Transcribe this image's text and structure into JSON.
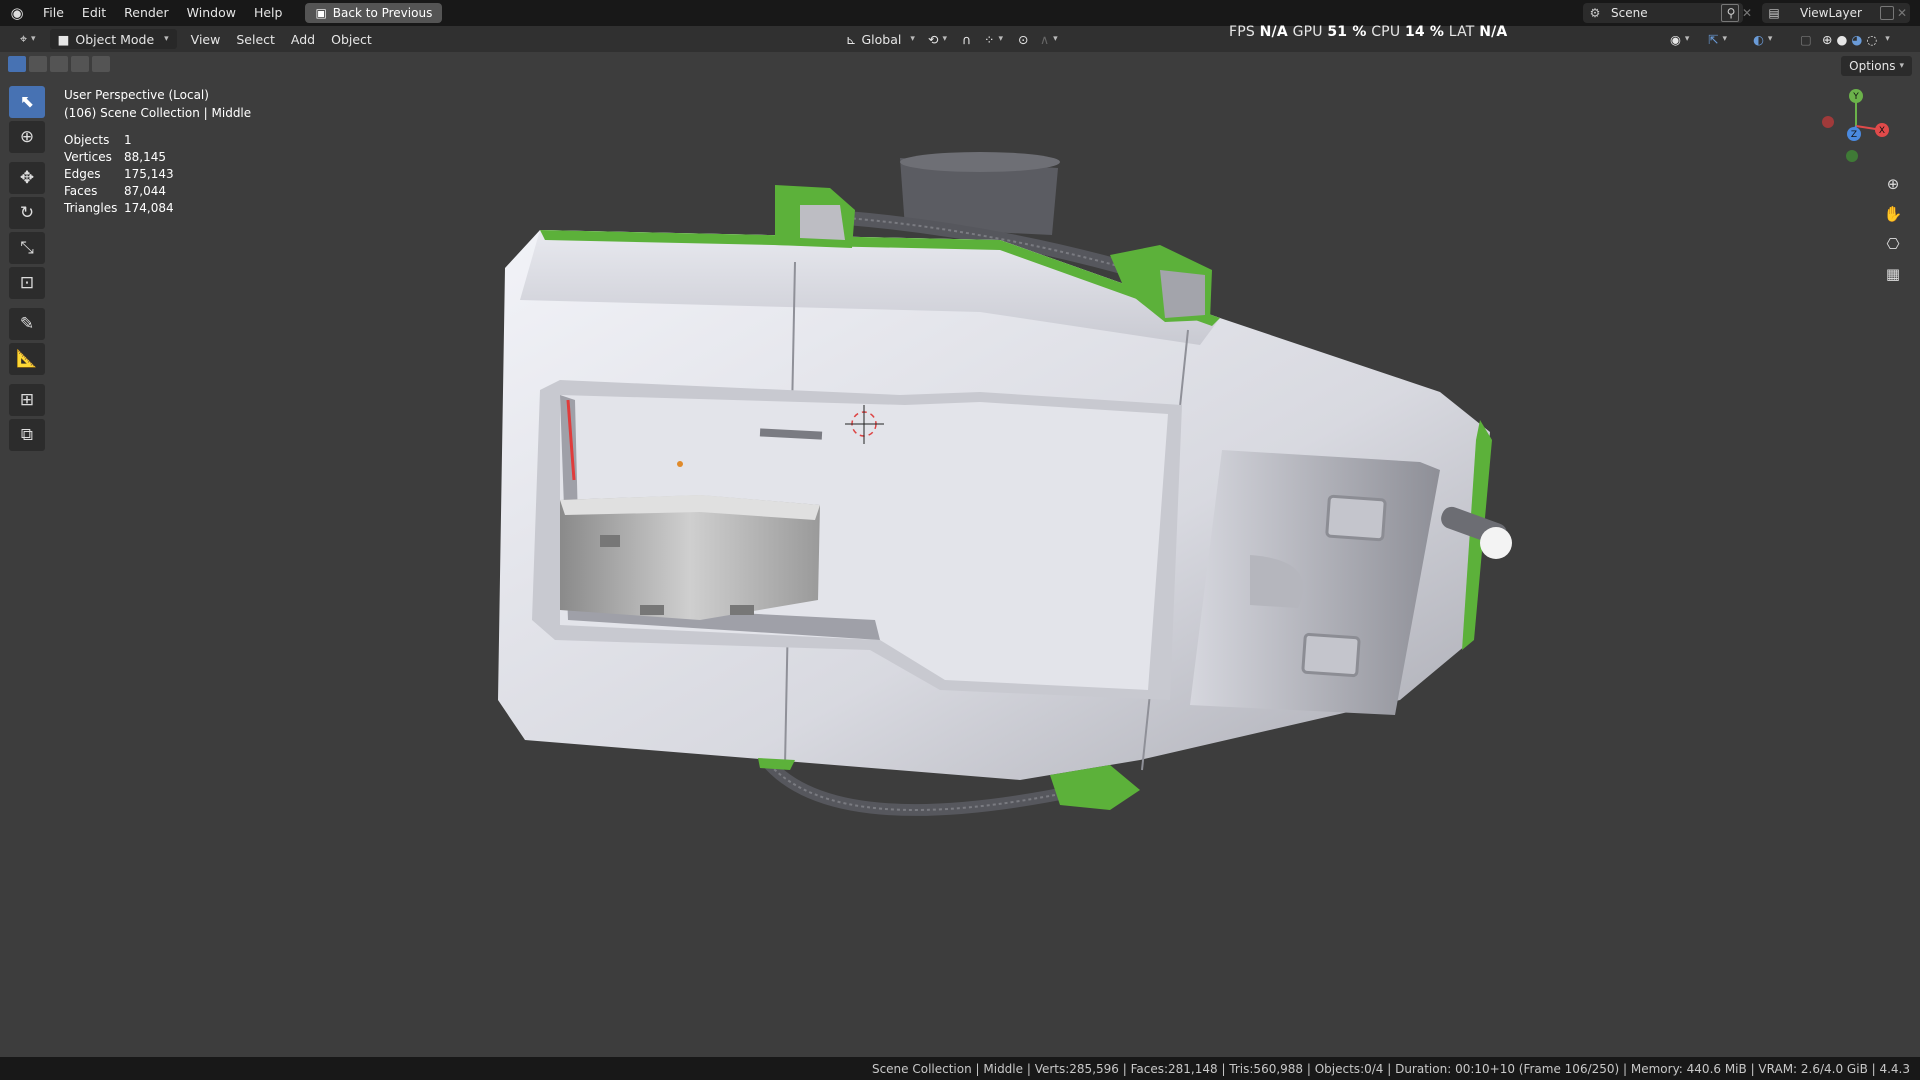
{
  "menu": {
    "items": [
      "File",
      "Edit",
      "Render",
      "Window",
      "Help"
    ],
    "back_label": "Back to Previous"
  },
  "scene": {
    "name": "Scene",
    "view_layer": "ViewLayer"
  },
  "header": {
    "mode": "Object Mode",
    "view": "View",
    "select": "Select",
    "add": "Add",
    "object": "Object",
    "transform_orientation": "Global"
  },
  "perf": {
    "fps_label": "FPS",
    "fps": "N/A",
    "gpu_label": "GPU",
    "gpu": "51 %",
    "cpu_label": "CPU",
    "cpu": "14 %",
    "lat_label": "LAT",
    "lat": "N/A"
  },
  "viewport": {
    "perspective": "User Perspective (Local)",
    "collection": "(106) Scene Collection | Middle",
    "options_label": "Options",
    "stats": [
      {
        "label": "Objects",
        "value": "1"
      },
      {
        "label": "Vertices",
        "value": "88,145"
      },
      {
        "label": "Edges",
        "value": "175,143"
      },
      {
        "label": "Faces",
        "value": "87,044"
      },
      {
        "label": "Triangles",
        "value": "174,084"
      }
    ]
  },
  "gizmo": {
    "y": "Y",
    "x": "X",
    "z": "Z"
  },
  "statusbar": {
    "text": "Scene Collection | Middle | Verts:285,596 | Faces:281,148 | Tris:560,988 | Objects:0/4 | Duration: 00:10+10 (Frame 106/250) | Memory: 440.6 MiB | VRAM: 2.6/4.0 GiB | 4.4.3"
  },
  "colors": {
    "accent": "#4772b3",
    "viewport_bg": "#3d3d3d",
    "green": "#5cb13a"
  }
}
